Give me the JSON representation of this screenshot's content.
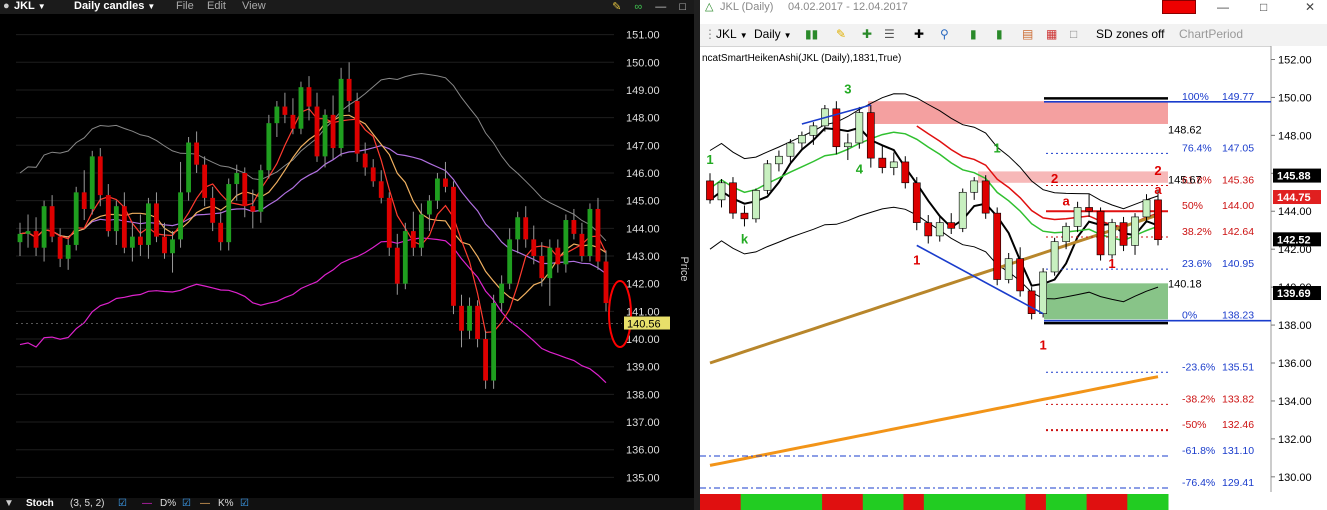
{
  "left_chart": {
    "symbol": "JKL",
    "period": "Daily candles",
    "menu": [
      "File",
      "Edit",
      "View"
    ],
    "price_axis_label": "Price",
    "last_price": "140.56",
    "indicator_bar": {
      "name": "Stoch",
      "params": "(3, 5, 2)",
      "d_label": "D%",
      "k_label": "K%"
    },
    "colors": {
      "up": "#1f9e1f",
      "down": "#dd0000",
      "background": "#000000",
      "ma_red": "#ff3b2f",
      "ma_orange": "#f0b060",
      "ma_violet": "#b070e0",
      "band_gray": "#888888",
      "band_magenta": "#dd22cc",
      "highlight": "#ff0000"
    }
  },
  "right_chart": {
    "title_symbol": "JKL (Daily)",
    "date_range": "04.02.2017 - 12.04.2017",
    "toolbar": {
      "symbol": "JKL",
      "period": "Daily",
      "sd_zones": "SD zones off",
      "chart_period": "ChartPeriod"
    },
    "indicator_label": "ncatSmartHeikenAshi(JKL (Daily),1831,True)",
    "fib_levels": [
      {
        "label": "100%",
        "value": "149.77"
      },
      {
        "label": "76.4%",
        "value": "147.05"
      },
      {
        "label": "61.8%",
        "value": "145.36"
      },
      {
        "label": "50%",
        "value": "144.00"
      },
      {
        "label": "38.2%",
        "value": "142.64"
      },
      {
        "label": "23.6%",
        "value": "140.95"
      },
      {
        "label": "0%",
        "value": "138.23"
      },
      {
        "label": "-23.6%",
        "value": "135.51"
      },
      {
        "label": "-38.2%",
        "value": "133.82"
      },
      {
        "label": "-50%",
        "value": "132.46"
      },
      {
        "label": "-61.8%",
        "value": "131.10"
      },
      {
        "label": "-76.4%",
        "value": "129.41"
      }
    ],
    "annotations": {
      "zone_top": "148.62",
      "zone_mid": "145.67",
      "zone_bot": "140.18"
    },
    "wave_labels": [
      "3",
      "4",
      "k",
      "1",
      "1",
      "2",
      "a",
      "a",
      "1",
      "1",
      "2",
      "1"
    ],
    "price_tags": {
      "t1": "145.88",
      "t2": "144.75",
      "t3": "142.52",
      "t4": "139.69"
    },
    "colors": {
      "up": "#22bb22",
      "down": "#dd0000",
      "zone_red": "#f4a0a0",
      "zone_green": "#88c488",
      "fib_blue": "#1a3ccc",
      "fib_red": "#cc1111",
      "ma_tan": "#b8862b",
      "ma_orange": "#f29418"
    }
  },
  "chart_data": [
    {
      "type": "candlestick",
      "title": "JKL Daily candles",
      "ylabel": "Price",
      "ylim": [
        134.4,
        151.6
      ],
      "yticks": [
        "151.00",
        "150.00",
        "149.00",
        "148.00",
        "147.00",
        "146.00",
        "145.00",
        "144.00",
        "143.00",
        "142.00",
        "141.00",
        "140.00",
        "139.00",
        "138.00",
        "137.00",
        "136.00",
        "135.00"
      ],
      "candles": [
        [
          143.5,
          144.2,
          143.0,
          143.8
        ],
        [
          143.8,
          144.5,
          143.3,
          143.9
        ],
        [
          143.9,
          144.4,
          143.0,
          143.3
        ],
        [
          143.3,
          145.0,
          142.8,
          144.8
        ],
        [
          144.8,
          145.2,
          143.5,
          143.7
        ],
        [
          143.7,
          144.0,
          142.6,
          142.9
        ],
        [
          142.9,
          143.6,
          142.5,
          143.4
        ],
        [
          143.4,
          145.5,
          143.2,
          145.3
        ],
        [
          145.3,
          146.1,
          144.3,
          144.7
        ],
        [
          144.7,
          146.8,
          144.5,
          146.6
        ],
        [
          146.6,
          146.9,
          144.8,
          145.2
        ],
        [
          145.2,
          145.6,
          143.7,
          143.9
        ],
        [
          143.9,
          145.0,
          143.4,
          144.8
        ],
        [
          144.8,
          145.3,
          143.1,
          143.3
        ],
        [
          143.3,
          144.2,
          142.8,
          143.7
        ],
        [
          143.7,
          144.5,
          143.0,
          143.4
        ],
        [
          143.4,
          145.1,
          142.9,
          144.9
        ],
        [
          144.9,
          145.3,
          143.5,
          143.7
        ],
        [
          143.7,
          144.2,
          142.9,
          143.1
        ],
        [
          143.1,
          143.9,
          142.4,
          143.6
        ],
        [
          143.6,
          146.4,
          143.3,
          145.3
        ],
        [
          145.3,
          147.3,
          145.0,
          147.1
        ],
        [
          147.1,
          147.5,
          146.0,
          146.3
        ],
        [
          146.3,
          146.6,
          144.8,
          145.1
        ],
        [
          145.1,
          145.5,
          143.9,
          144.2
        ],
        [
          144.2,
          144.6,
          143.2,
          143.5
        ],
        [
          143.5,
          145.8,
          143.2,
          145.6
        ],
        [
          145.6,
          146.3,
          145.0,
          146.0
        ],
        [
          146.0,
          146.2,
          144.4,
          144.8
        ],
        [
          144.8,
          145.4,
          144.0,
          144.6
        ],
        [
          144.6,
          146.3,
          144.2,
          146.1
        ],
        [
          146.1,
          148.1,
          145.8,
          147.8
        ],
        [
          147.8,
          148.6,
          147.3,
          148.4
        ],
        [
          148.4,
          148.9,
          147.8,
          148.1
        ],
        [
          148.1,
          148.7,
          147.4,
          147.6
        ],
        [
          147.6,
          149.3,
          147.4,
          149.1
        ],
        [
          149.1,
          149.5,
          147.9,
          148.4
        ],
        [
          148.4,
          148.9,
          146.4,
          146.6
        ],
        [
          146.6,
          148.3,
          146.2,
          148.1
        ],
        [
          148.1,
          148.8,
          146.5,
          146.9
        ],
        [
          146.9,
          149.8,
          146.6,
          149.4
        ],
        [
          149.4,
          150.0,
          148.2,
          148.6
        ],
        [
          148.6,
          148.9,
          146.4,
          146.7
        ],
        [
          146.7,
          147.1,
          145.9,
          146.2
        ],
        [
          146.2,
          146.5,
          145.5,
          145.7
        ],
        [
          145.7,
          146.1,
          144.9,
          145.1
        ],
        [
          145.1,
          145.3,
          143.0,
          143.3
        ],
        [
          143.3,
          143.8,
          141.6,
          142.0
        ],
        [
          142.0,
          144.2,
          141.8,
          143.9
        ],
        [
          143.9,
          144.6,
          143.0,
          143.3
        ],
        [
          143.3,
          144.9,
          143.0,
          144.5
        ],
        [
          144.5,
          145.2,
          143.9,
          145.0
        ],
        [
          145.0,
          146.0,
          144.7,
          145.8
        ],
        [
          145.8,
          146.4,
          145.3,
          145.5
        ],
        [
          145.5,
          145.7,
          140.9,
          141.2
        ],
        [
          141.2,
          141.6,
          139.7,
          140.3
        ],
        [
          140.3,
          141.5,
          140.0,
          141.2
        ],
        [
          141.2,
          141.4,
          139.7,
          140.0
        ],
        [
          140.0,
          140.3,
          138.2,
          138.5
        ],
        [
          138.5,
          141.6,
          138.2,
          141.3
        ],
        [
          141.3,
          142.3,
          141.0,
          142.0
        ],
        [
          142.0,
          144.0,
          141.8,
          143.6
        ],
        [
          143.6,
          144.6,
          143.1,
          144.4
        ],
        [
          144.4,
          144.8,
          143.3,
          143.6
        ],
        [
          143.6,
          144.1,
          142.7,
          143.0
        ],
        [
          143.0,
          143.5,
          141.9,
          142.2
        ],
        [
          142.2,
          143.6,
          141.2,
          143.3
        ],
        [
          143.3,
          143.6,
          142.4,
          142.7
        ],
        [
          142.7,
          144.5,
          142.4,
          144.3
        ],
        [
          144.3,
          144.7,
          143.6,
          143.8
        ],
        [
          143.8,
          144.2,
          142.8,
          143.0
        ],
        [
          143.0,
          144.9,
          142.8,
          144.7
        ],
        [
          144.7,
          145.1,
          142.5,
          142.8
        ],
        [
          142.8,
          143.2,
          141.0,
          141.3
        ]
      ],
      "last_price": 140.56
    },
    {
      "type": "candlestick",
      "title": "JKL (Daily)",
      "ylim": [
        129.2,
        152.5
      ],
      "yticks": [
        "152.00",
        "150.00",
        "148.00",
        "146.00",
        "144.00",
        "142.00",
        "140.00",
        "138.00",
        "136.00",
        "134.00",
        "132.00",
        "130.00"
      ],
      "candles": [
        [
          145.6,
          146.0,
          144.4,
          144.6
        ],
        [
          144.6,
          145.7,
          144.2,
          145.5
        ],
        [
          145.5,
          145.8,
          143.6,
          143.9
        ],
        [
          143.9,
          144.3,
          143.2,
          143.6
        ],
        [
          143.6,
          145.2,
          143.4,
          145.1
        ],
        [
          145.1,
          146.7,
          144.9,
          146.5
        ],
        [
          146.5,
          147.2,
          146.1,
          146.9
        ],
        [
          146.9,
          147.8,
          146.6,
          147.6
        ],
        [
          147.6,
          148.2,
          147.2,
          148.0
        ],
        [
          148.0,
          148.7,
          147.5,
          148.5
        ],
        [
          148.5,
          149.6,
          148.2,
          149.4
        ],
        [
          149.4,
          149.8,
          147.0,
          147.4
        ],
        [
          147.4,
          148.1,
          146.7,
          147.6
        ],
        [
          147.6,
          149.5,
          147.3,
          149.2
        ],
        [
          149.2,
          149.6,
          146.3,
          146.8
        ],
        [
          146.8,
          147.5,
          146.0,
          146.3
        ],
        [
          146.3,
          147.1,
          145.9,
          146.6
        ],
        [
          146.6,
          146.9,
          145.2,
          145.5
        ],
        [
          145.5,
          145.8,
          143.0,
          143.4
        ],
        [
          143.4,
          143.8,
          142.3,
          142.7
        ],
        [
          142.7,
          143.7,
          142.4,
          143.4
        ],
        [
          143.4,
          143.9,
          142.8,
          143.1
        ],
        [
          143.1,
          145.2,
          142.9,
          145.0
        ],
        [
          145.0,
          145.8,
          144.6,
          145.6
        ],
        [
          145.6,
          145.9,
          143.6,
          143.9
        ],
        [
          143.9,
          144.2,
          140.1,
          140.4
        ],
        [
          140.4,
          141.8,
          140.2,
          141.5
        ],
        [
          141.5,
          142.1,
          139.5,
          139.8
        ],
        [
          139.8,
          140.0,
          138.3,
          138.6
        ],
        [
          138.6,
          141.0,
          138.4,
          140.8
        ],
        [
          140.8,
          142.6,
          140.6,
          142.4
        ],
        [
          142.4,
          143.4,
          142.0,
          143.2
        ],
        [
          143.2,
          144.5,
          142.9,
          144.2
        ],
        [
          144.2,
          144.9,
          143.7,
          144.0
        ],
        [
          144.0,
          144.2,
          141.4,
          141.7
        ],
        [
          141.7,
          143.6,
          141.5,
          143.4
        ],
        [
          143.4,
          143.7,
          141.9,
          142.2
        ],
        [
          142.2,
          143.9,
          141.7,
          143.7
        ],
        [
          143.7,
          144.9,
          143.4,
          144.6
        ],
        [
          144.6,
          145.1,
          142.2,
          142.5
        ]
      ],
      "fib_levels": [
        149.77,
        147.05,
        145.36,
        144.0,
        142.64,
        140.95,
        138.23,
        135.51,
        133.82,
        132.46,
        131.1,
        129.41
      ],
      "last_price": 144.75
    }
  ]
}
